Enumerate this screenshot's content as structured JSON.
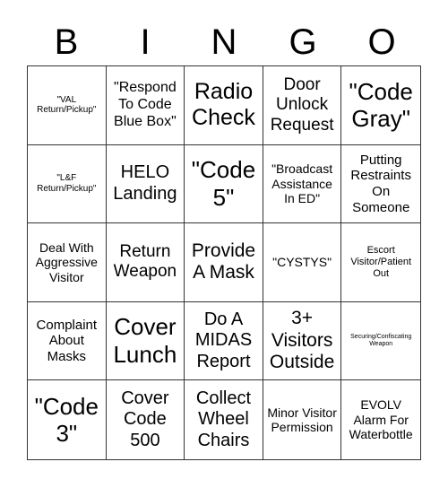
{
  "header": [
    "B",
    "I",
    "N",
    "G",
    "O"
  ],
  "cells": [
    "\"VAL Return/Pickup\"",
    "\"Respond To Code Blue Box\"",
    "Radio Check",
    "Door Unlock Request",
    "\"Code Gray\"",
    "\"L&F Return/Pickup\"",
    "HELO Landing",
    "\"Code 5\"",
    "\"Broadcast Assistance In ED\"",
    "Putting Restraints On Someone",
    "Deal With Aggressive Visitor",
    "Return Weapon",
    "Provide A Mask",
    "\"CYSTYS\"",
    "Escort Visitor/Patient Out",
    "Complaint About Masks",
    "Cover Lunch",
    "Do A MIDAS Report",
    "3+ Visitors Outside",
    "Securing/Confiscating Weapon",
    "\"Code 3\"",
    "Cover Code 500",
    "Collect Wheel Chairs",
    "Minor Visitor Permission",
    "EVOLV Alarm For Waterbottle"
  ]
}
